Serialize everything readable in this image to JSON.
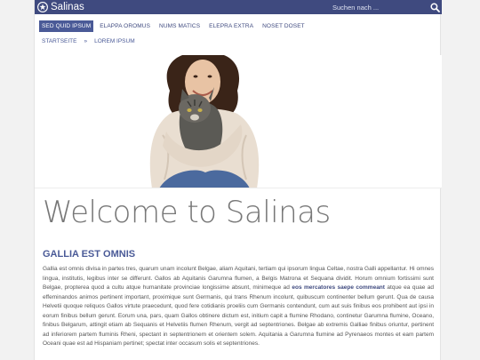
{
  "header": {
    "brand": "Salinas",
    "search_placeholder": "Suchen nach ...",
    "colors": {
      "topbar": "#3f4a7f",
      "accent": "#4a5a97",
      "page_bg": "#ffffff",
      "outer_bg": "#f2f2f2"
    }
  },
  "nav": {
    "items": [
      {
        "label": "SED QUID IPSUM",
        "active": true
      },
      {
        "label": "ELAPPA OROMUS",
        "active": false
      },
      {
        "label": "NUMS MATICS",
        "active": false
      },
      {
        "label": "ELEPRA EXTRA",
        "active": false
      },
      {
        "label": "NOSET DOSET",
        "active": false
      }
    ]
  },
  "breadcrumb": {
    "home": "STARTSEITE",
    "separator": "»",
    "current": "LOREM IPSUM"
  },
  "main": {
    "title": "Welcome to Salinas",
    "subtitle": "GALLIA EST OMNIS",
    "paragraph_before": "Gallia est omnis divisa in partes tres, quarum unam incolunt Belgae, aliam Aquitani, tertiam qui ipsorum lingua Celtae, nostra Galli appellantur. Hi omnes lingua, institutis, legibus inter se differunt. Gallos ab Aquitanis Garumna flumen, a Belgis Matrona et Sequana dividit. Horum omnium fortissimi sunt Belgae, propterea quod a cultu atque humanitate provinciae longissime absunt, minimeque ad",
    "paragraph_link": "eos mercatores saepe commeant",
    "paragraph_after": "atque ea quae ad effeminandos animos pertinent important, proximique sunt Germanis, qui trans Rhenum incolunt, quibuscum continenter bellum gerunt. Qua de causa Helvetii quoque reliquos Gallos virtute praecedunt, quod fere cotidianis proeliis cum Germanis contendunt, cum aut suis finibus eos prohibent aut ipsi in eorum finibus bellum gerunt. Eorum una, pars, quam Gallos obtinere dictum est, initium capit a flumine Rhodano, continetur Garumna flumine, Oceano, finibus Belgarum, attingit etiam ab Sequanis et Helvetiis flumen Rhenum, vergit ad septentriones. Belgae ab extremis Galliae finibus oriuntur, pertinent ad inferiorem partem fluminis Rheni, spectant in septentrionem et orientem solem. Aquitania a Garumna flumine ad Pyrenaeos montes et eam partem Oceani quae est ad Hispaniam pertinet; spectat inter occasum solis et septentriones."
  }
}
